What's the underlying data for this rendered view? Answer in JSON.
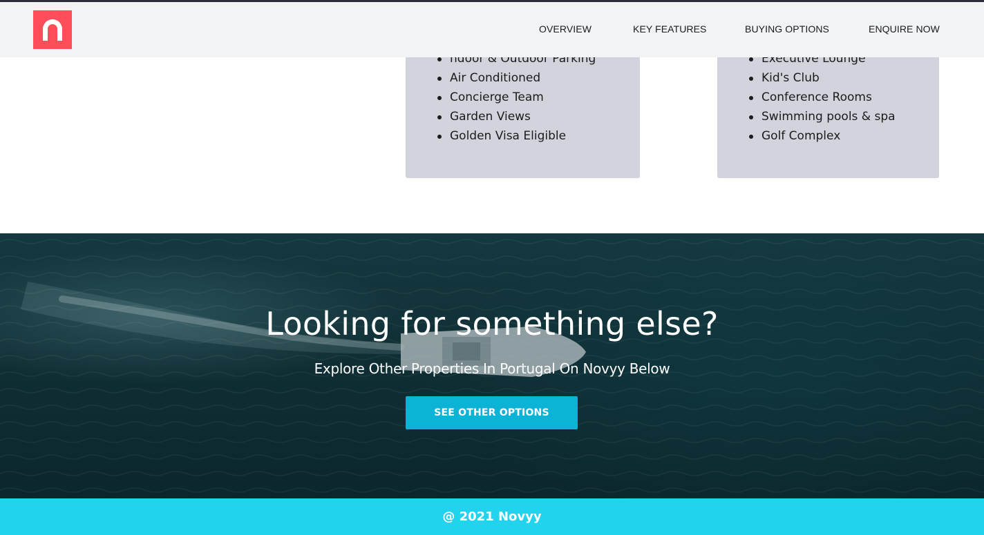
{
  "brand": {
    "logo_color": "#ff4d5a",
    "logo_icon": "n-arch-logo"
  },
  "nav": {
    "items": [
      {
        "label": "OVERVIEW"
      },
      {
        "label": "KEY FEATURES"
      },
      {
        "label": "BUYING OPTIONS"
      },
      {
        "label": "ENQUIRE NOW"
      }
    ]
  },
  "features": {
    "left_list": [
      "ndoor & Outdoor Parking",
      "Air Conditioned",
      "Concierge Team",
      "Garden Views",
      "Golden Visa Eligible"
    ],
    "right_list": [
      "Executive Lounge",
      "Kid's Club",
      "Conference Rooms",
      "Swimming pools & spa",
      "Golf Complex"
    ],
    "card_color": "#d1d4dc"
  },
  "hero": {
    "title": "Looking for something else?",
    "subtitle": "Explore Other Properties In Portugal On Novyy Below",
    "cta_label": "SEE OTHER OPTIONS",
    "cta_color": "#0bb3d6"
  },
  "footer": {
    "text": "@ 2021 Novyy",
    "color": "#21d3ec"
  }
}
